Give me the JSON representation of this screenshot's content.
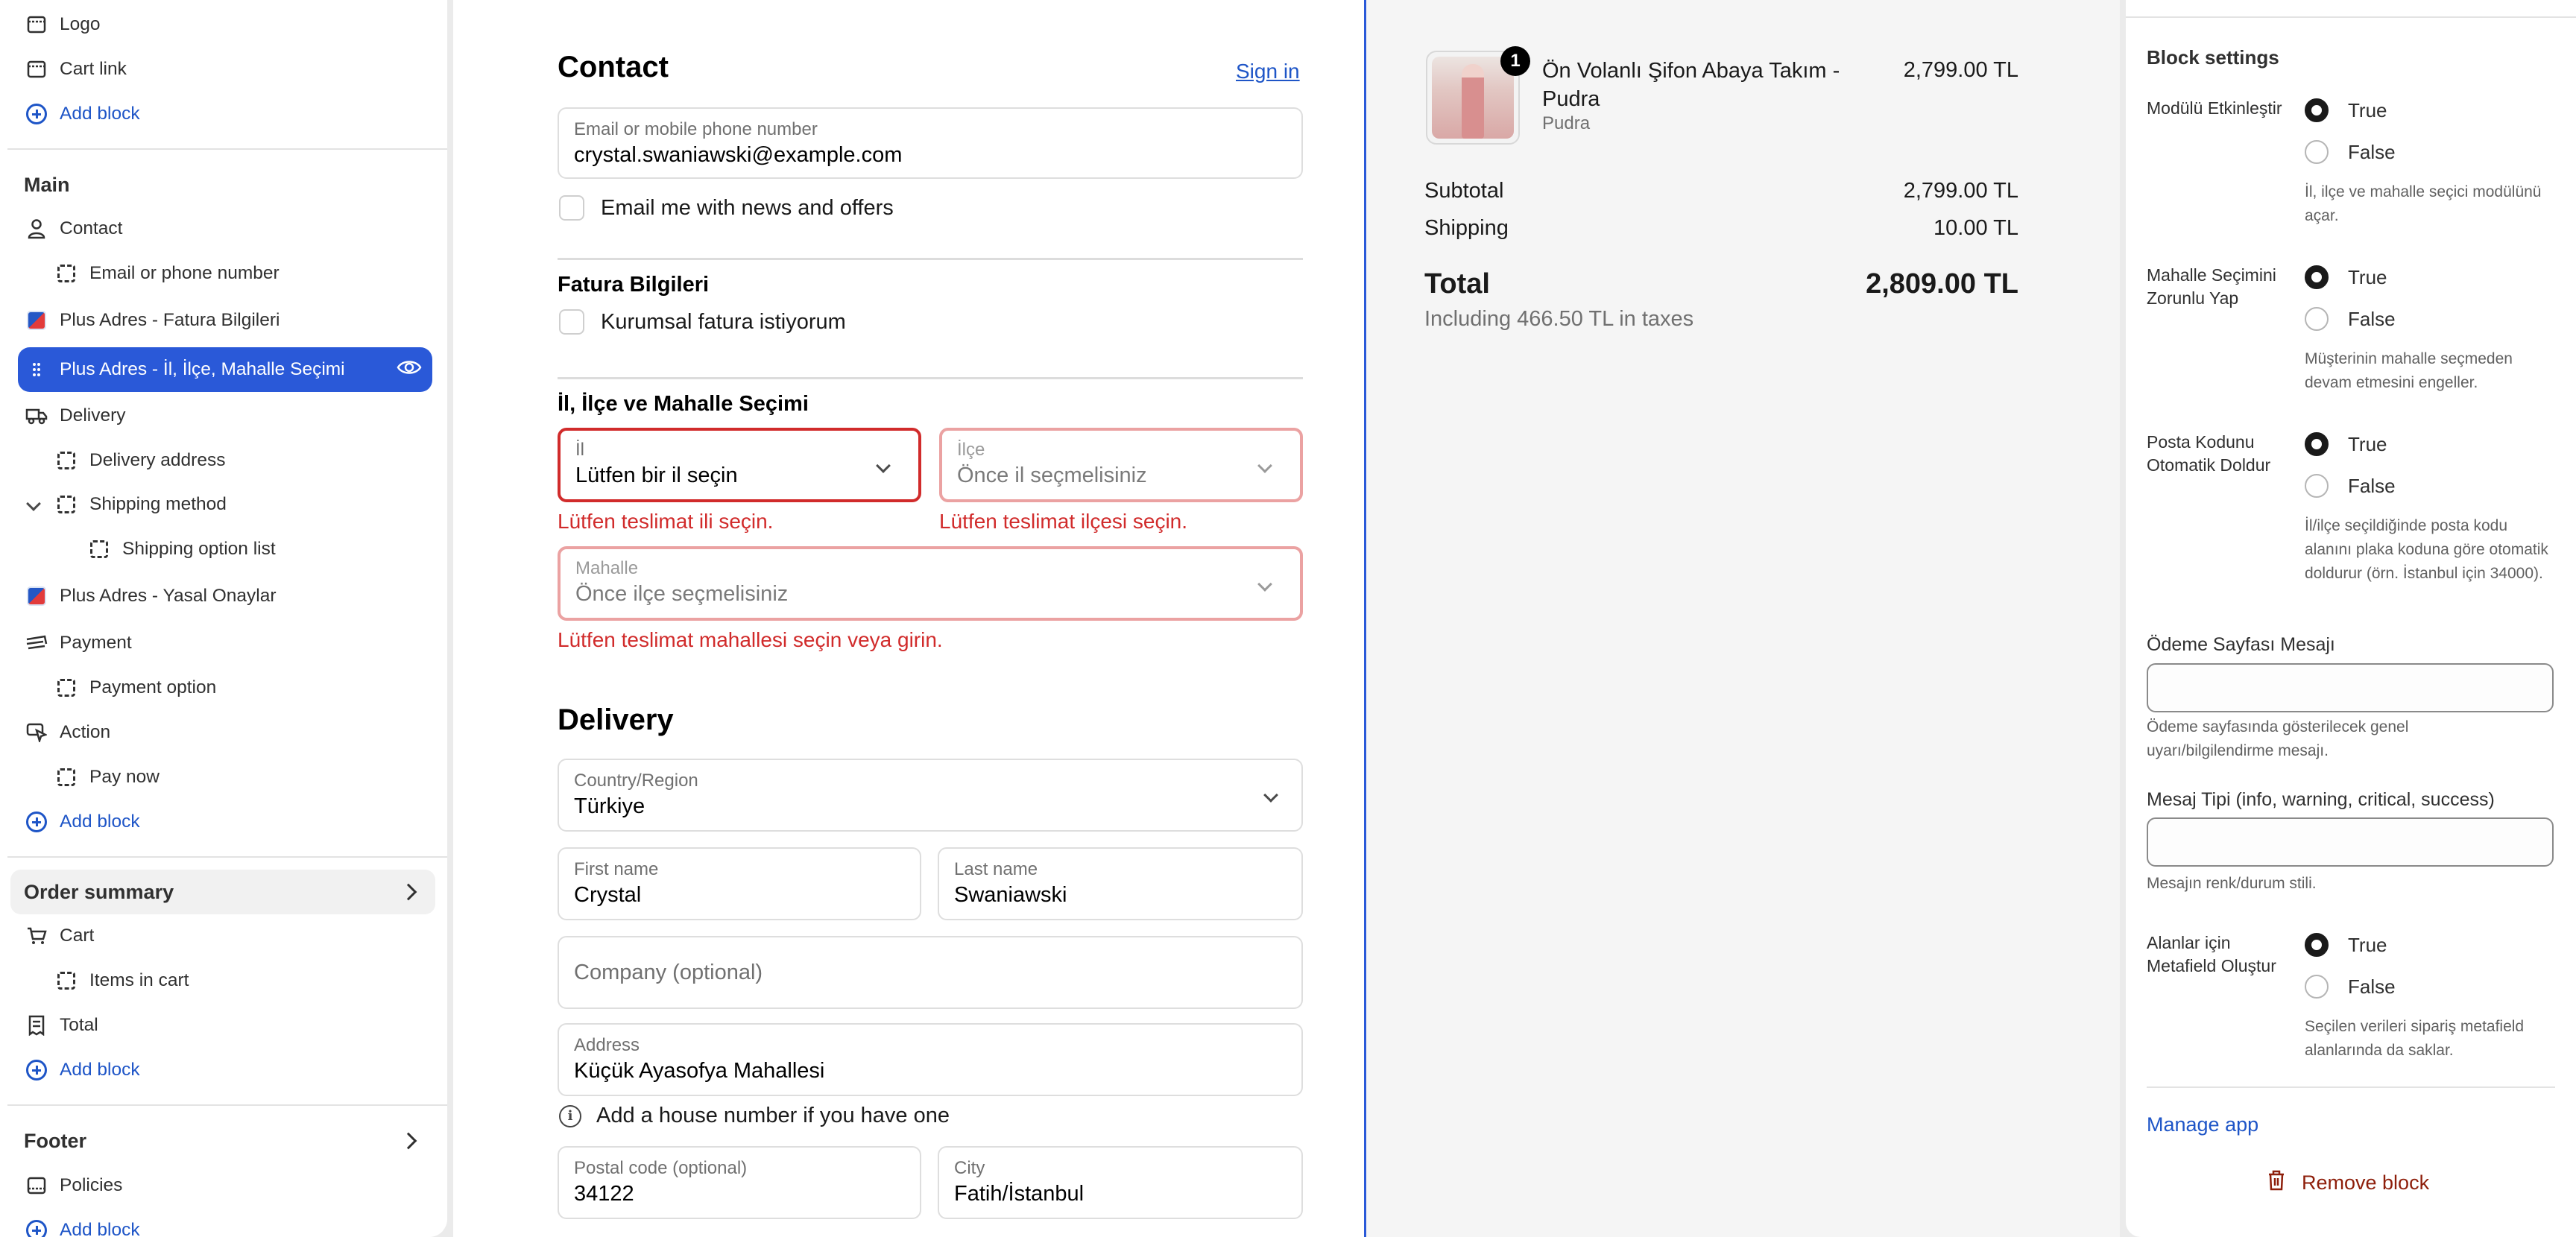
{
  "sidebar": {
    "header_items": [
      {
        "label": "Logo",
        "icon": "header-block-icon"
      },
      {
        "label": "Cart link",
        "icon": "header-block-icon"
      },
      {
        "label": "Add block",
        "icon": "add-circle-icon"
      }
    ],
    "main_title": "Main",
    "main_items": [
      {
        "label": "Contact",
        "icon": "person-icon"
      },
      {
        "label": "Email or phone number",
        "icon": "dashed-square-icon"
      },
      {
        "label": "Plus Adres - Fatura Bilgileri",
        "icon": "app-icon"
      },
      {
        "label": "Plus Adres - İl, İlçe, Mahalle Seçimi",
        "icon": "app-icon"
      },
      {
        "label": "Delivery",
        "icon": "truck-icon"
      },
      {
        "label": "Delivery address",
        "icon": "dashed-square-icon"
      },
      {
        "label": "Shipping method",
        "icon": "dashed-square-icon"
      },
      {
        "label": "Shipping option list",
        "icon": "dashed-square-icon"
      },
      {
        "label": "Plus Adres - Yasal Onaylar",
        "icon": "app-icon"
      },
      {
        "label": "Payment",
        "icon": "cash-icon"
      },
      {
        "label": "Payment option",
        "icon": "dashed-square-icon"
      },
      {
        "label": "Action",
        "icon": "cursor-icon"
      },
      {
        "label": "Pay now",
        "icon": "dashed-square-icon"
      },
      {
        "label": "Add block",
        "icon": "add-circle-icon"
      }
    ],
    "order_summary": {
      "title": "Order summary",
      "items": [
        {
          "label": "Cart",
          "icon": "cart-icon"
        },
        {
          "label": "Items in cart",
          "icon": "dashed-square-icon"
        },
        {
          "label": "Total",
          "icon": "receipt-icon"
        },
        {
          "label": "Add block",
          "icon": "add-circle-icon"
        }
      ]
    },
    "footer": {
      "title": "Footer",
      "items": [
        {
          "label": "Policies",
          "icon": "header-block-icon"
        },
        {
          "label": "Add block",
          "icon": "add-circle-icon"
        }
      ]
    }
  },
  "checkout": {
    "contact": {
      "title": "Contact",
      "sign_in": "Sign in",
      "email_label": "Email or mobile phone number",
      "email_value": "crystal.swaniawski@example.com",
      "news_label": "Email me with news and offers"
    },
    "invoice": {
      "title": "Fatura Bilgileri",
      "corporate_label": "Kurumsal fatura istiyorum"
    },
    "district": {
      "title": "İl, İlçe ve Mahalle Seçimi",
      "il_label": "İl",
      "il_value": "Lütfen bir il seçin",
      "il_error": "Lütfen teslimat ili seçin.",
      "ilce_label": "İlçe",
      "ilce_value": "Önce il seçmelisiniz",
      "ilce_error": "Lütfen teslimat ilçesi seçin.",
      "mahalle_label": "Mahalle",
      "mahalle_value": "Önce ilçe seçmelisiniz",
      "mahalle_error": "Lütfen teslimat mahallesi seçin veya girin."
    },
    "delivery": {
      "title": "Delivery",
      "country_label": "Country/Region",
      "country_value": "Türkiye",
      "first_name_label": "First name",
      "first_name_value": "Crystal",
      "last_name_label": "Last name",
      "last_name_value": "Swaniawski",
      "company_placeholder": "Company (optional)",
      "address_label": "Address",
      "address_value": "Küçük Ayasofya Mahallesi",
      "house_hint": "Add a house number if you have one",
      "postal_label": "Postal code (optional)",
      "postal_value": "34122",
      "city_label": "City",
      "city_value": "Fatih/İstanbul"
    }
  },
  "order": {
    "badge": "1",
    "product_name": "Ön Volanlı Şifon Abaya Takım - Pudra",
    "variant": "Pudra",
    "price": "2,799.00 TL",
    "subtotal_label": "Subtotal",
    "subtotal_value": "2,799.00 TL",
    "shipping_label": "Shipping",
    "shipping_value": "10.00 TL",
    "total_label": "Total",
    "total_value": "2,809.00 TL",
    "taxes": "Including 466.50 TL in taxes"
  },
  "settings": {
    "title": "Block settings",
    "true_label": "True",
    "false_label": "False",
    "groups": [
      {
        "label": "Modülü Etkinleştir",
        "help": "İl, ilçe ve mahalle seçici modülünü açar."
      },
      {
        "label": "Mahalle Seçimini Zorunlu Yap",
        "help": "Müşterinin mahalle seçmeden devam etmesini engeller."
      },
      {
        "label": "Posta Kodunu Otomatik Doldur",
        "help": "İl/ilçe seçildiğinde posta kodu alanını plaka koduna göre otomatik doldurur (örn. İstanbul için 34000)."
      }
    ],
    "message_label": "Ödeme Sayfası Mesajı",
    "message_help": "Ödeme sayfasında gösterilecek genel uyarı/bilgilendirme mesajı.",
    "type_label": "Mesaj Tipi (info, warning, critical, success)",
    "type_help": "Mesajın renk/durum stili.",
    "metafield_label": "Alanlar için Metafield Oluştur",
    "metafield_help": "Seçilen verileri sipariş metafield alanlarında da saklar.",
    "manage_app": "Manage app",
    "remove_block": "Remove block"
  },
  "colors": {
    "accent": "#2a59d8",
    "link": "#1e55c7",
    "error": "#d12b2b",
    "destructive": "#8e1f0b"
  }
}
